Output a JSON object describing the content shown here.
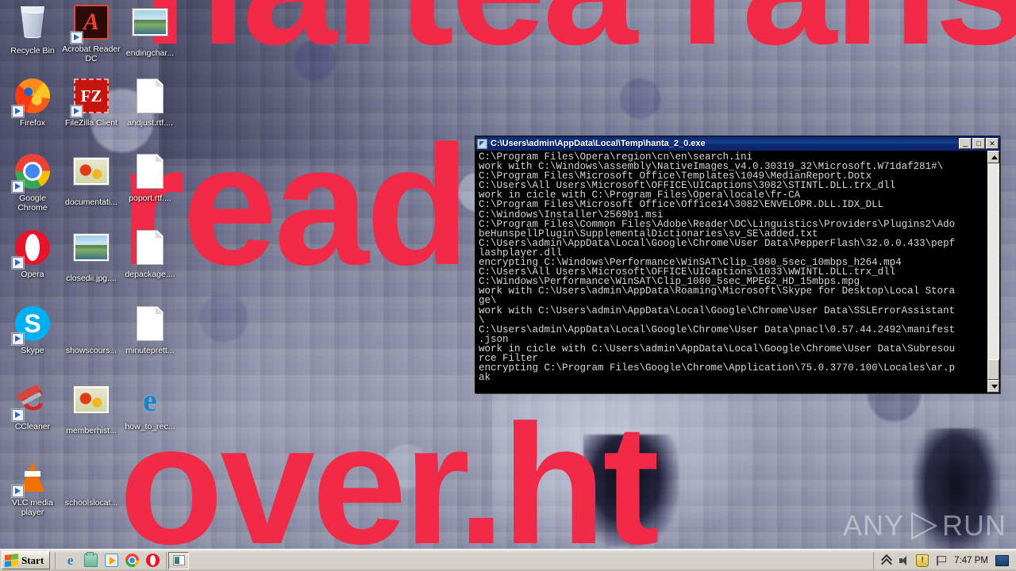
{
  "desktop": {
    "wallpaper": {
      "ransom_line_1": "nartea ranso",
      "ransom_line_2": "read",
      "ransom_line_3": "over.ht",
      "accent_red": "#f02a47",
      "background_base": "#6b6e86"
    },
    "icons": [
      {
        "label": "Recycle Bin",
        "icon": "recycle-bin-icon",
        "shortcut": false
      },
      {
        "label": "Acrobat Reader DC",
        "icon": "acrobat-reader-icon",
        "shortcut": true
      },
      {
        "label": "endingchar...",
        "icon": "image-file-icon",
        "shortcut": false
      },
      {
        "label": "Firefox",
        "icon": "firefox-icon",
        "shortcut": true
      },
      {
        "label": "FileZilla Client",
        "icon": "filezilla-icon",
        "shortcut": true
      },
      {
        "label": "andjust.rtf....",
        "icon": "document-file-icon",
        "shortcut": false
      },
      {
        "label": "Google Chrome",
        "icon": "chrome-icon",
        "shortcut": true
      },
      {
        "label": "documentati...",
        "icon": "flower-image-icon",
        "shortcut": false
      },
      {
        "label": "poport.rtf....",
        "icon": "document-file-icon",
        "shortcut": false
      },
      {
        "label": "Opera",
        "icon": "opera-icon",
        "shortcut": true
      },
      {
        "label": "closedii.jpg....",
        "icon": "image-file-icon",
        "shortcut": false
      },
      {
        "label": "depackage....",
        "icon": "document-file-icon",
        "shortcut": false
      },
      {
        "label": "Skype",
        "icon": "skype-icon",
        "shortcut": true
      },
      {
        "label": "showscours...",
        "icon": "blank-icon",
        "shortcut": false
      },
      {
        "label": "minuteprett...",
        "icon": "document-file-icon",
        "shortcut": false
      },
      {
        "label": "CCleaner",
        "icon": "ccleaner-icon",
        "shortcut": true
      },
      {
        "label": "memberhist...",
        "icon": "flower-image-icon",
        "shortcut": false
      },
      {
        "label": "how_to_rec...",
        "icon": "internet-explorer-html-icon",
        "shortcut": false
      },
      {
        "label": "VLC media player",
        "icon": "vlc-icon",
        "shortcut": true
      },
      {
        "label": "schoolslocat...",
        "icon": "blank-icon",
        "shortcut": false
      }
    ]
  },
  "console_window": {
    "title": "C:\\Users\\admin\\AppData\\Local\\Temp\\hanta_2_0.exe",
    "title_icon": "console-window-icon",
    "buttons": {
      "minimize": "_",
      "maximize": "□",
      "close": "✕"
    },
    "scrollbar": {
      "up_arrow": "▲",
      "down_arrow": "▼",
      "thumb_position": "bottom"
    },
    "output": "C:\\Program Files\\Opera\\region\\cn\\en\\search.ini\nwork with C:\\Windows\\assembly\\NativeImages_v4.0.30319_32\\Microsoft.W71daf281#\\\nC:\\Program Files\\Microsoft Office\\Templates\\1049\\MedianReport.Dotx\nC:\\Users\\All Users\\Microsoft\\OFFICE\\UICaptions\\3082\\STINTL.DLL.trx_dll\nwork in cicle with C:\\Program Files\\Opera\\locale\\fr-CA\nC:\\Program Files\\Microsoft Office\\Office14\\3082\\ENVELOPR.DLL.IDX_DLL\nC:\\Windows\\Installer\\2569b1.msi\nC:\\Program Files\\Common Files\\Adobe\\Reader\\DC\\Linguistics\\Providers\\Plugins2\\Ado\nbeHunspellPlugin\\SupplementalDictionaries\\sv_SE\\added.txt\nC:\\Users\\admin\\AppData\\Local\\Google\\Chrome\\User Data\\PepperFlash\\32.0.0.433\\pepf\nlashplayer.dll\nencrypting C:\\Windows\\Performance\\WinSAT\\Clip_1080_5sec_10mbps_h264.mp4\nC:\\Users\\All Users\\Microsoft\\OFFICE\\UICaptions\\1033\\WWINTL.DLL.trx_dll\nC:\\Windows\\Performance\\WinSAT\\Clip_1080_5sec_MPEG2_HD_15mbps.mpg\nwork with C:\\Users\\admin\\AppData\\Roaming\\Microsoft\\Skype for Desktop\\Local Stora\nge\\\nwork with C:\\Users\\admin\\AppData\\Local\\Google\\Chrome\\User Data\\SSLErrorAssistant\n\\\nC:\\Users\\admin\\AppData\\Local\\Google\\Chrome\\User Data\\pnacl\\0.57.44.2492\\manifest\n.json\nwork in cicle with C:\\Users\\admin\\AppData\\Local\\Google\\Chrome\\User Data\\Subresou\nrce Filter\nencrypting C:\\Program Files\\Google\\Chrome\\Application\\75.0.3770.100\\Locales\\ar.p\nak"
  },
  "taskbar": {
    "start_label": "Start",
    "start_icon": "windows-flag-icon",
    "quick_launch": [
      {
        "name": "internet-explorer-icon"
      },
      {
        "name": "show-desktop-folder-icon"
      },
      {
        "name": "windows-media-player-icon"
      },
      {
        "name": "chrome-icon"
      },
      {
        "name": "opera-icon"
      }
    ],
    "tasks": [
      {
        "name": "hanta-console-task",
        "icon": "console-window-icon"
      }
    ],
    "systray": [
      {
        "name": "show-hidden-icons-chevron-icon"
      },
      {
        "name": "volume-icon"
      },
      {
        "name": "action-center-shield-icon"
      },
      {
        "name": "network-flag-icon"
      }
    ],
    "clock": "7:47 PM",
    "tray_end_icon": "monitor-icon"
  },
  "watermark": {
    "prefix": "ANY",
    "suffix": "RUN",
    "play_icon": "play-triangle-icon"
  }
}
